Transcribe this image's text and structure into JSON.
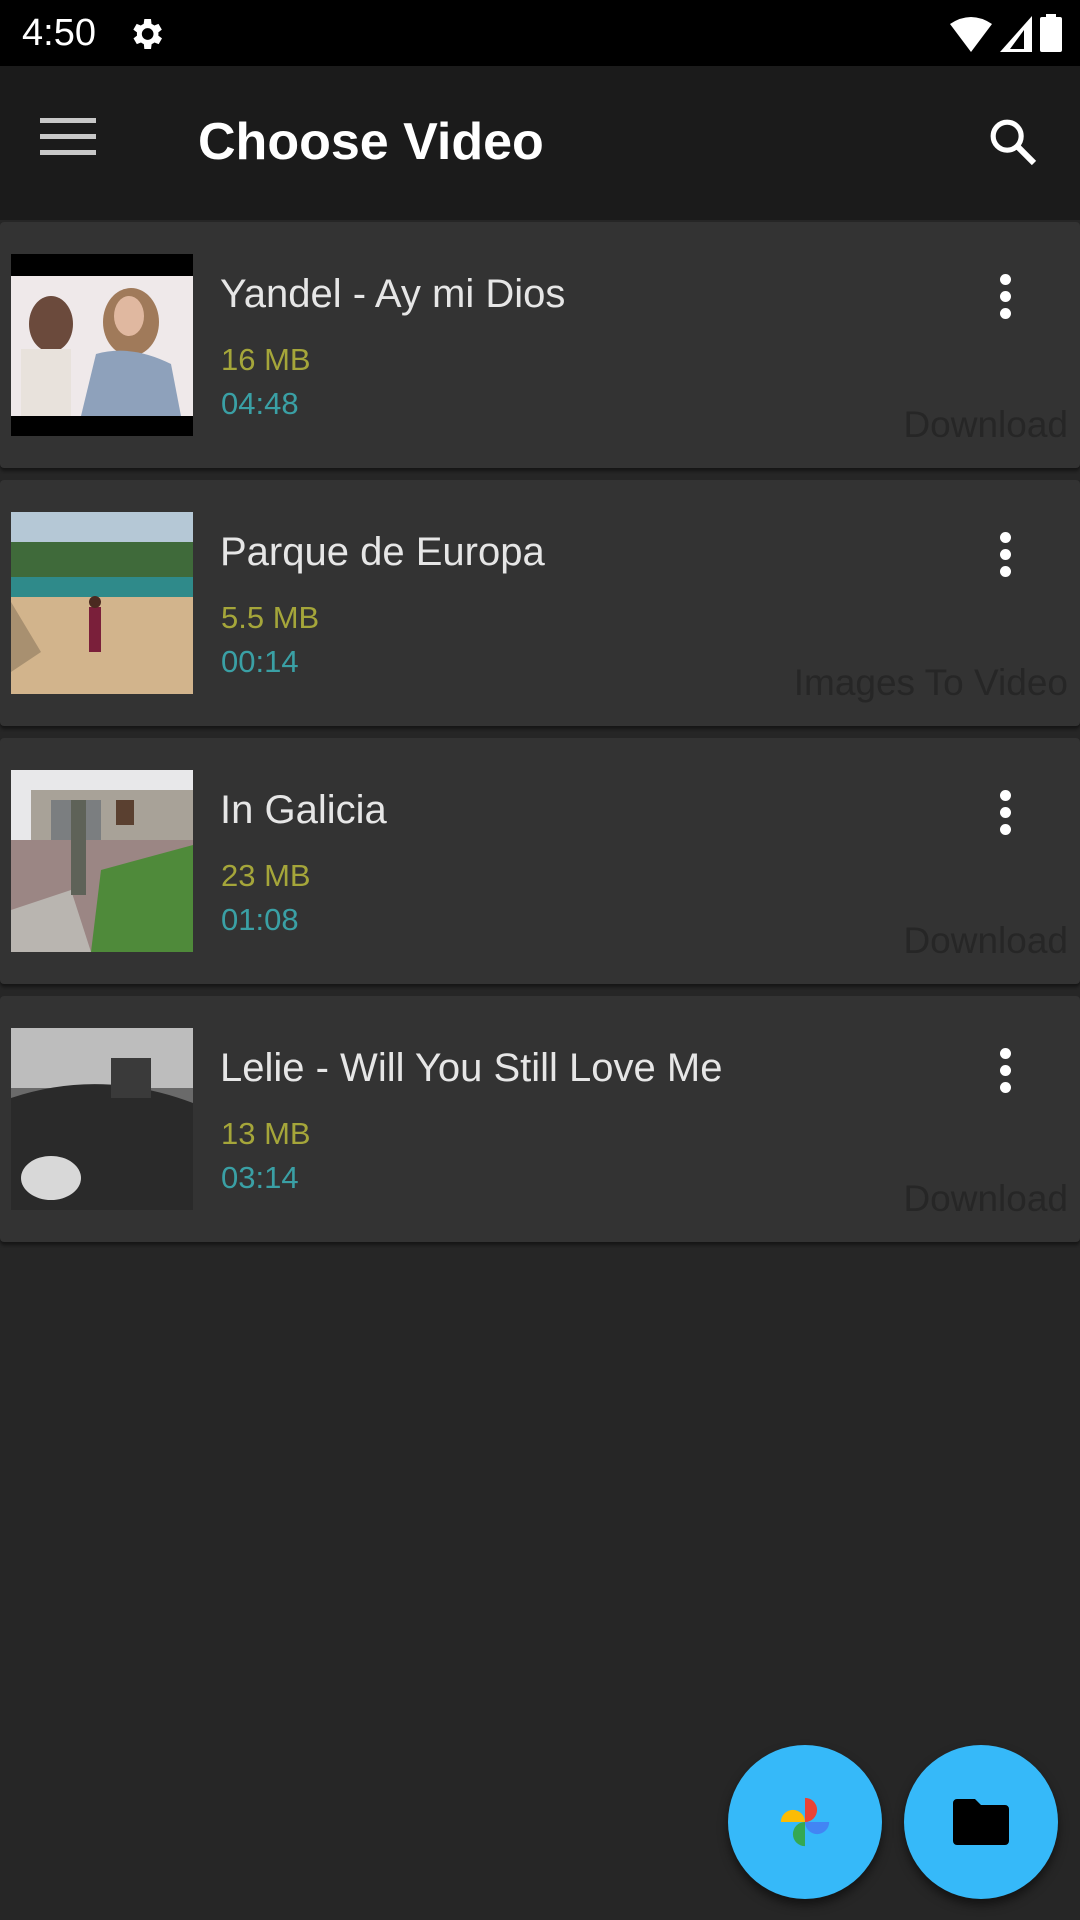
{
  "status_bar": {
    "time": "4:50"
  },
  "app_bar": {
    "title": "Choose Video"
  },
  "videos": [
    {
      "title": "Yandel - Ay mi Dios",
      "size": "16 MB",
      "duration": "04:48",
      "action": "Download",
      "thumb": "couple"
    },
    {
      "title": "Parque de Europa",
      "size": "5.5 MB",
      "duration": "00:14",
      "action": "Images To Video",
      "thumb": "park"
    },
    {
      "title": "In Galicia",
      "size": "23 MB",
      "duration": "01:08",
      "action": "Download",
      "thumb": "house"
    },
    {
      "title": "Lelie - Will You Still Love Me",
      "size": "13 MB",
      "duration": "03:14",
      "action": "Download",
      "thumb": "car"
    }
  ],
  "fabs": [
    {
      "icon": "google-photos-icon"
    },
    {
      "icon": "folder-icon"
    }
  ],
  "colors": {
    "accent": "#36b9f9",
    "size_text": "#a5a63a",
    "duration_text": "#3aa0a5"
  }
}
